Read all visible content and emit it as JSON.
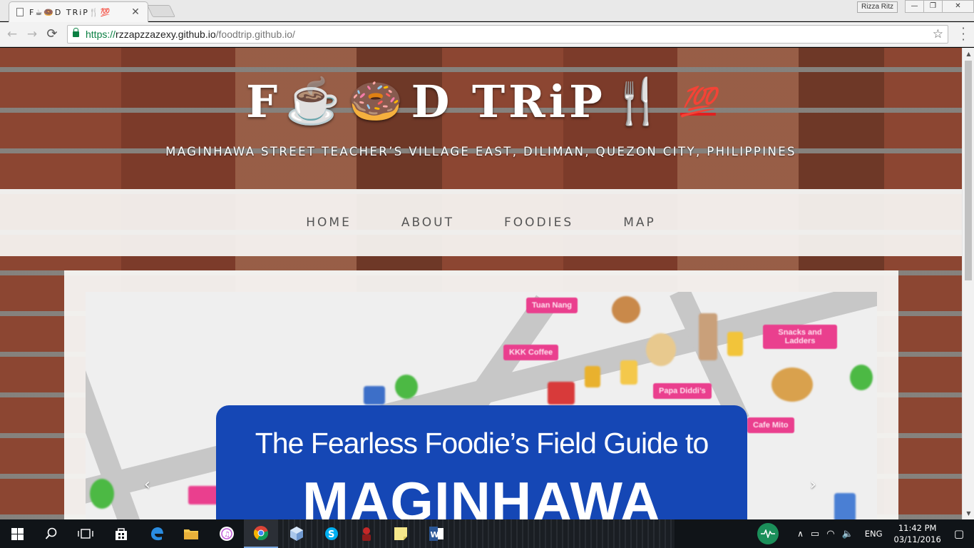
{
  "browser": {
    "tab_title": "F☕🍩D TRiP🍴💯",
    "tab_close": "✕",
    "profile_name": "Rizza Ritz",
    "url_scheme": "https://",
    "url_host": "rzzapzzazexy.github.io",
    "url_path": "/foodtrip.github.io/",
    "back_glyph": "←",
    "forward_glyph": "→",
    "reload_glyph": "⟳",
    "star_glyph": "☆"
  },
  "site": {
    "logo_parts": [
      "F",
      "☕",
      "🍩",
      "D TRiP",
      "🍴",
      "💯"
    ],
    "tagline": "MAGINHAWA STREET TEACHER’S VILLAGE EAST, DILIMAN, QUEZON CITY, PHILIPPINES",
    "nav": [
      {
        "label": "HOME"
      },
      {
        "label": "ABOUT"
      },
      {
        "label": "FOODIES"
      },
      {
        "label": "MAP"
      }
    ]
  },
  "carousel": {
    "slide_subtitle": "The Fearless Foodie’s Field Guide to",
    "slide_title": "MAGINHAWA",
    "map_labels": [
      "Tuan Nang",
      "KKK Coffee",
      "Snacks and Ladders",
      "Papa Diddi’s",
      "Cafe Mito"
    ],
    "prev_glyph": "‹",
    "next_glyph": "›"
  },
  "taskbar": {
    "time": "11:42 PM",
    "date": "03/11/2016",
    "language": "ENG"
  },
  "colors": {
    "brand_blue": "#1547b5",
    "map_pink": "#ea3f8e",
    "ssl_green": "#0b8043"
  }
}
